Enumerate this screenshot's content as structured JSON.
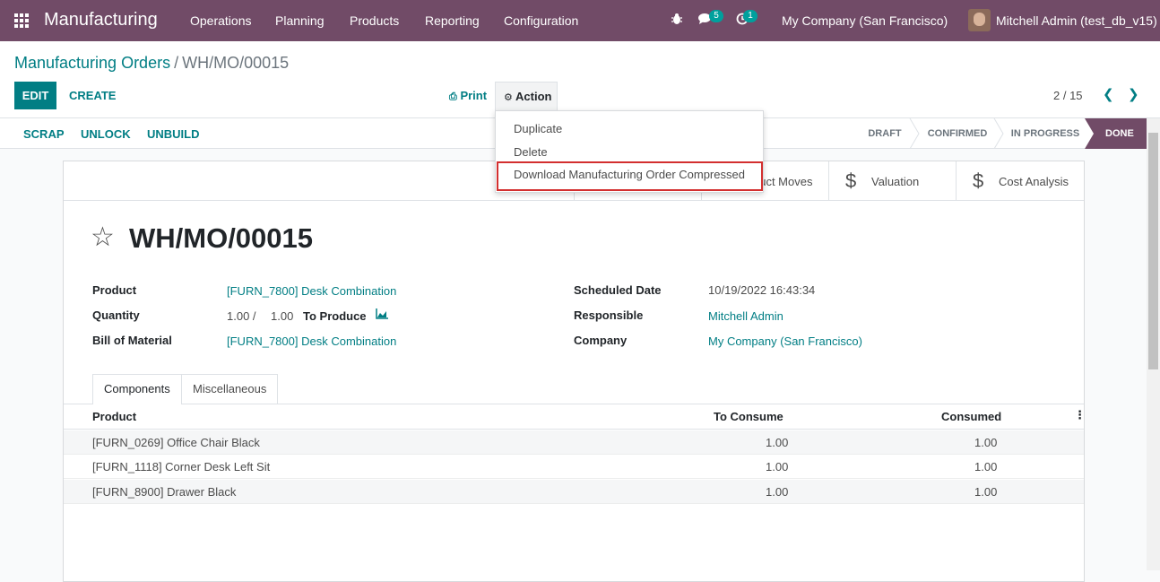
{
  "navbar": {
    "brand": "Manufacturing",
    "menu": [
      "Operations",
      "Planning",
      "Products",
      "Reporting",
      "Configuration"
    ],
    "messages_count": "5",
    "activities_count": "1",
    "company": "My Company (San Francisco)",
    "user": "Mitchell Admin (test_db_v15)",
    "bg_color": "#714b67"
  },
  "breadcrumb": {
    "parent": "Manufacturing Orders",
    "separator": "/",
    "current": "WH/MO/00015"
  },
  "toolbar": {
    "edit_label": "EDIT",
    "create_label": "CREATE",
    "print_label": "Print",
    "action_label": "Action",
    "pager": "2 / 15"
  },
  "action_menu": {
    "items": [
      "Duplicate",
      "Delete",
      "Download Manufacturing Order Compressed"
    ],
    "highlighted": "Download Manufacturing Order Compressed"
  },
  "statusbar": {
    "buttons": [
      "SCRAP",
      "UNLOCK",
      "UNBUILD"
    ],
    "stages": [
      "DRAFT",
      "CONFIRMED",
      "IN PROGRESS",
      "DONE"
    ],
    "active_stage": "DONE"
  },
  "smart_buttons": {
    "moves_label": "duct Moves",
    "valuation_label": "Valuation",
    "cost_label": "Cost Analysis"
  },
  "record": {
    "title": "WH/MO/00015",
    "left_fields": [
      {
        "label": "Product",
        "value": "[FURN_7800] Desk Combination"
      },
      {
        "label": "Quantity",
        "value": "1.00 /",
        "value2": "1.00",
        "suffix": "To Produce"
      },
      {
        "label": "Bill of Material",
        "value": "[FURN_7800] Desk Combination"
      }
    ],
    "right_fields": [
      {
        "label": "Scheduled Date",
        "value": "10/19/2022 16:43:34"
      },
      {
        "label": "Responsible",
        "value": "Mitchell Admin"
      },
      {
        "label": "Company",
        "value": "My Company (San Francisco)"
      }
    ]
  },
  "tabs": [
    "Components",
    "Miscellaneous"
  ],
  "components": {
    "columns": [
      "Product",
      "To Consume",
      "Consumed"
    ],
    "rows": [
      {
        "product": "[FURN_0269] Office Chair Black",
        "to_consume": "1.00",
        "consumed": "1.00"
      },
      {
        "product": "[FURN_1118] Corner Desk Left Sit",
        "to_consume": "1.00",
        "consumed": "1.00"
      },
      {
        "product": "[FURN_8900] Drawer Black",
        "to_consume": "1.00",
        "consumed": "1.00"
      }
    ]
  }
}
